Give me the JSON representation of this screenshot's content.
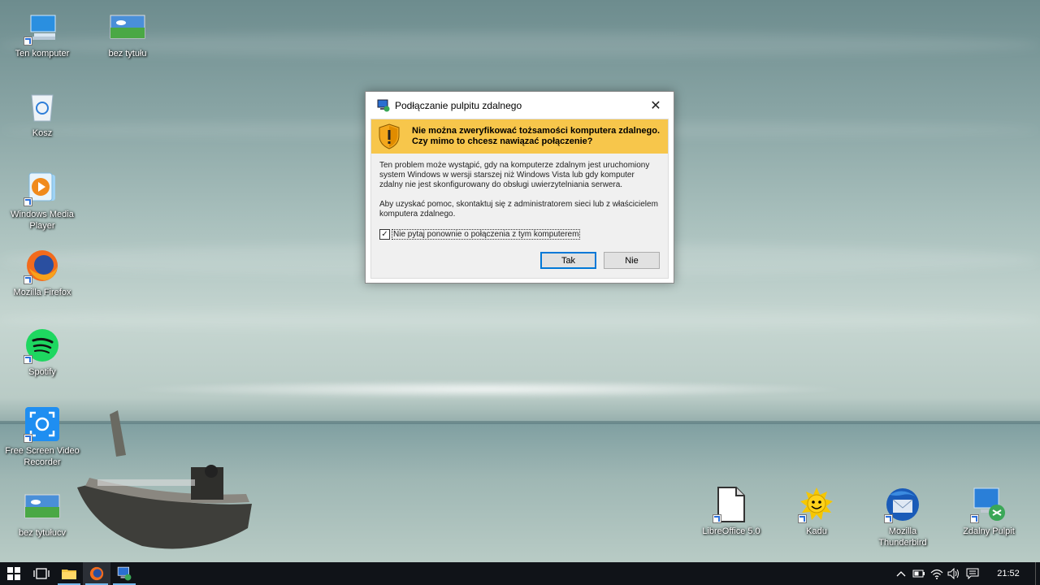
{
  "desktop": {
    "icons": [
      {
        "label": "Ten komputer",
        "icon": "computer-icon"
      },
      {
        "label": "bez tytułu",
        "icon": "image-file-icon"
      },
      {
        "label": "Kosz",
        "icon": "recycle-bin-icon"
      },
      {
        "label": "Windows Media Player",
        "icon": "media-player-icon"
      },
      {
        "label": "Mozilla Firefox",
        "icon": "firefox-icon"
      },
      {
        "label": "Spotify",
        "icon": "spotify-icon"
      },
      {
        "label": "Free Screen Video Recorder",
        "icon": "screen-recorder-icon"
      },
      {
        "label": "bez tytułucv",
        "icon": "image-file-icon"
      },
      {
        "label": "LibreOffice 5.0",
        "icon": "libreoffice-icon"
      },
      {
        "label": "Kadu",
        "icon": "kadu-sun-icon"
      },
      {
        "label": "Mozilla Thunderbird",
        "icon": "thunderbird-icon"
      },
      {
        "label": "Zdalny Pulpit",
        "icon": "remote-desktop-icon"
      }
    ]
  },
  "dialog": {
    "title": "Podłączanie pulpitu zdalnego",
    "warning_line1": "Nie można zweryfikować tożsamości komputera zdalnego.",
    "warning_line2": "Czy mimo to chcesz nawiązać połączenie?",
    "paragraph1": "Ten problem może wystąpić, gdy na komputerze zdalnym jest uruchomiony system Windows w wersji starszej niż Windows Vista lub gdy komputer zdalny nie jest skonfigurowany do obsługi uwierzytelniania serwera.",
    "paragraph2": "Aby uzyskać pomoc, skontaktuj się z administratorem sieci lub z właścicielem komputera zdalnego.",
    "checkbox_label": "Nie pytaj ponownie o połączenia z tym komputerem",
    "checkbox_checked": true,
    "yes_button": "Tak",
    "no_button": "Nie",
    "banner_color": "#f7c64b"
  },
  "taskbar": {
    "items": [
      "start-icon",
      "task-view-icon",
      "file-explorer-icon",
      "firefox-icon",
      "remote-desktop-icon"
    ],
    "clock": "21:52",
    "tray": [
      "chevron-up-icon",
      "battery-icon",
      "wifi-icon",
      "volume-icon",
      "action-center-icon"
    ]
  }
}
